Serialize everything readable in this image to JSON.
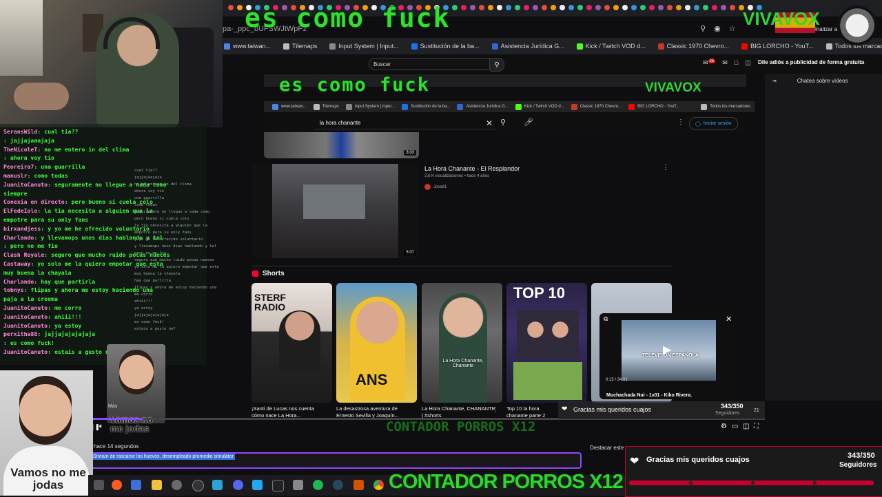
{
  "overlay": {
    "top_text": "es como fuck",
    "second_text": "es como fuck",
    "vox": "VIVAVOX",
    "contador": "CONTADOR PORROS X12",
    "contador_dim": "CONTADOR PORROS X12"
  },
  "browser": {
    "url_fragment": "pa-_ppc_bUFSWJtWpPz",
    "finalizar": "inalizar a",
    "bookmarks": [
      {
        "label": "www.taiwan...",
        "color": "#4a86e8"
      },
      {
        "label": "Tilemaps",
        "color": "#bbbbbb"
      },
      {
        "label": "Input System | Input...",
        "color": "#888888"
      },
      {
        "label": "Sustitución de la ba...",
        "color": "#1a73e8"
      },
      {
        "label": "Asistencia Jurídica G...",
        "color": "#3366cc"
      },
      {
        "label": "Kick / Twitch VOD d...",
        "color": "#53fc18"
      },
      {
        "label": "Classic 1970 Chevro...",
        "color": "#c0392b"
      },
      {
        "label": "BIG LORCHO - YouT...",
        "color": "#ff0000"
      },
      {
        "label": "Todos los marcadores",
        "color": "#bbbbbb"
      }
    ],
    "search_placeholder": "Buscar",
    "ad_banner": "Dile adiós a publicidad de forma gratuita",
    "notif_count": "25",
    "chat_header": "Chatea sobre vídeos"
  },
  "inner_browser": {
    "bookmarks": [
      {
        "label": "www.taiwan...",
        "color": "#4a86e8"
      },
      {
        "label": "Tilemaps",
        "color": "#bbbbbb"
      },
      {
        "label": "Input System | Input...",
        "color": "#888888"
      },
      {
        "label": "Sustitución de la ba...",
        "color": "#1a73e8"
      },
      {
        "label": "Asistencia Jurídica G...",
        "color": "#3366cc"
      },
      {
        "label": "Kick / Twitch VOD d...",
        "color": "#53fc18"
      },
      {
        "label": "Classic 1970 Chevro...",
        "color": "#c0392b"
      },
      {
        "label": "BIG LORCHO - YouT...",
        "color": "#ff0000"
      },
      {
        "label": "Todos los marcadores",
        "color": "#bbbbbb"
      }
    ]
  },
  "youtube": {
    "search_query": "la hora chanante",
    "login": "Iniciar sesión",
    "prev_duration": "3:03",
    "video": {
      "title": "La Hora Chanante - El Resplandor",
      "meta": "3,6 K visualizaciones • hace 4 años",
      "channel": "Jose81",
      "duration": "5:07"
    },
    "shorts_heading": "Shorts",
    "shorts": [
      {
        "title": "¡Santi de Lucas nos cuenta cómo nace La Hora...",
        "banner": "STERF RADIO"
      },
      {
        "title": "La desastrosa aventura de Ernesto Sevilla y Joaquín...",
        "banner": "ANS"
      },
      {
        "title": "La Hora Chanante, CHANANTE | #shorts",
        "banner": "La Hora Chanante, Chanante"
      },
      {
        "title": "Top 10 la hora chanante parte 2",
        "banner": "TOP 10"
      }
    ],
    "mini_player": {
      "time": "0:15 / 34:01",
      "title": "Muchachada Nui - 1x01 - Kiko Rivera.",
      "overlay": "TELEVISIÓN ESPAÑOLA"
    }
  },
  "chat": {
    "lines": [
      {
        "user": "SeransWild",
        "msg": ": cual tia??"
      },
      {
        "user": "",
        "msg": ": jajjajaaajaja"
      },
      {
        "user": "TheNicoleT",
        "msg": ": no me entero in del clima"
      },
      {
        "user": "",
        "msg": ": ahora voy tio"
      },
      {
        "user": "Peoreira7",
        "msg": ": una guarrilla"
      },
      {
        "user": "manuslr",
        "msg": ": como todas"
      },
      {
        "user": "JuanitoCanuto",
        "msg": ": seguramente no llegue a nada como"
      },
      {
        "user": "",
        "msg": "siempre"
      },
      {
        "user": "Conexia en directo",
        "msg": ": pero bueno si cuela colo"
      },
      {
        "user": "ElFedeIolo",
        "msg": ": la tia necesita a alguien que la"
      },
      {
        "user": "",
        "msg": "empotre para su only fans"
      },
      {
        "user": "birxandjess",
        "msg": ": y yo me he ofrecido voluntario"
      },
      {
        "user": "Charlando",
        "msg": ": y llevamops unos dias hablando y tal"
      },
      {
        "user": "",
        "msg": ": pero no me fio"
      },
      {
        "user": "Clash Royale",
        "msg": ": seguro que mucho ruido pocas nueces"
      },
      {
        "user": "Castaway",
        "msg": ": yo solo me la quiero empotar que esta"
      },
      {
        "user": "",
        "msg": "muy buena la chayala"
      },
      {
        "user": "Charlando",
        "msg": ": hay que partirla"
      },
      {
        "user": "tobnys",
        "msg": ": flipas y ahora me estoy haciendo una"
      },
      {
        "user": "",
        "msg": "paja a la creema"
      },
      {
        "user": "JuanitoCanuto",
        "msg": ": me corro"
      },
      {
        "user": "JuanitoCanuto",
        "msg": ": ahiii!!!"
      },
      {
        "user": "JuanitoCanuto",
        "msg": ": ya estoy"
      },
      {
        "user": "perxitha88",
        "msg": ": jajjajajajajaja"
      },
      {
        "user": "",
        "msg": ": es como fuck!"
      },
      {
        "user": "JuanitoCanuto",
        "msg": ": estais a gusto no?"
      }
    ],
    "ghost": "cual tia??\njajjajaajaja\nno me entero in del clima\nahora voy tio\nuna guarrilla\ncomo todas\nseguramente no llegue a nada como\npero bueno si cuela colo\nla tia necesita a alguien que la\nempotre para su only fans\ny yo me he ofrecido voluntario\ny llevamops unos dias hablando y tal\npero no me fio\nseguro que mucho ruido pocas nueces\nyo solo me la quiero empotar que esta\nmuy buena la chayala\nhay que partirla\nflipas y ahora me estoy haciendo una\nme corro\nahiii!!!\nya estoy\njajjajajajajaja\nes como fuck!\nestais a gusto no?"
  },
  "face": {
    "caption": "Vamos no me jodas",
    "small_caption": "Vamos no me jodas",
    "mas": "Más"
  },
  "player": {
    "progress": 0.08,
    "side_count": "21"
  },
  "comment": {
    "time_ago": "hace 14 segundos",
    "text": "Stream de rascarse los huevos, desempleado promedio simulator",
    "destacar": "Destacar este"
  },
  "goal": {
    "label": "Gracias mis queridos cuajos",
    "count": "343/350",
    "sub": "Seguidores",
    "fraction": 0.98
  },
  "colors": {
    "overlay_green": "#2fe02f",
    "twitch_purple": "#9147ff",
    "goal_red": "#c3002f"
  }
}
